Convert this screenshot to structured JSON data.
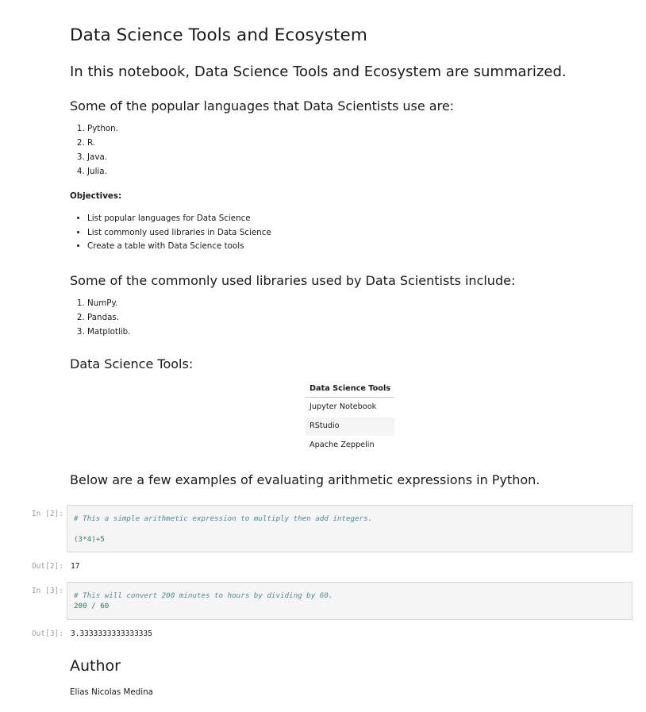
{
  "title": "Data Science Tools and Ecosystem",
  "intro": "In this notebook, Data Science Tools and Ecosystem are summarized.",
  "languages_heading": "Some of the popular languages that Data Scientists use are:",
  "languages": [
    "Python.",
    "R.",
    "Java.",
    "Julia."
  ],
  "objectives_label": "Objectives:",
  "objectives": [
    "List popular languages for Data Science",
    "List commonly used libraries in Data Science",
    "Create a table with Data Science tools"
  ],
  "libraries_heading": "Some of the commonly used libraries used by Data Scientists include:",
  "libraries": [
    "NumPy.",
    "Pandas.",
    "Matplotlib."
  ],
  "tools_heading": "Data Science Tools:",
  "tools_table": {
    "header": "Data Science Tools",
    "rows": [
      "Jupyter Notebook",
      "RStudio",
      "Apache Zeppelin"
    ]
  },
  "examples_heading": "Below are a few examples of evaluating arithmetic expressions in Python.",
  "cells": [
    {
      "in_prompt": "In [2]:",
      "comment": "# This a simple arithmetic expression to multiply then add integers.",
      "code": "(3*4)+5",
      "out_prompt": "Out[2]:",
      "output": "17"
    },
    {
      "in_prompt": "In [3]:",
      "comment": "# This will convert 200 minutes to hours by dividing by 60.",
      "code": "200 / 60",
      "out_prompt": "Out[3]:",
      "output": "3.3333333333333335"
    }
  ],
  "author_heading": "Author",
  "author_name": "Elias Nicolas Medina"
}
